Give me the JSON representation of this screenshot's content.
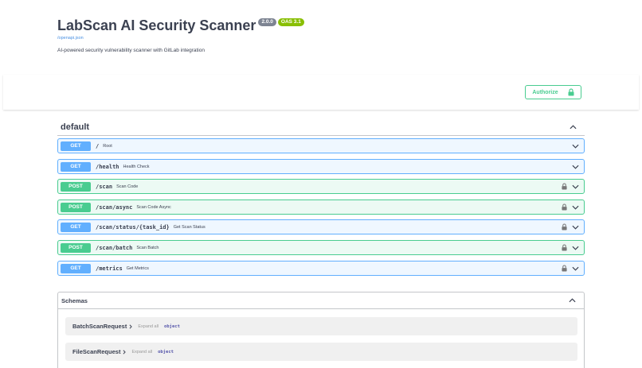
{
  "info": {
    "title": "LabScan AI Security Scanner",
    "version": "2.0.0",
    "oas": "OAS 3.1",
    "spec_link": "/openapi.json",
    "description": "AI-powered security vulnerability scanner with GitLab integration"
  },
  "authorize": {
    "label": "Authorize"
  },
  "tag": {
    "name": "default"
  },
  "operations": [
    {
      "method": "GET",
      "path": "/",
      "summary": "Root",
      "locked": false
    },
    {
      "method": "GET",
      "path": "/health",
      "summary": "Health Check",
      "locked": false
    },
    {
      "method": "POST",
      "path": "/scan",
      "summary": "Scan Code",
      "locked": true
    },
    {
      "method": "POST",
      "path": "/scan/async",
      "summary": "Scan Code Async",
      "locked": true
    },
    {
      "method": "GET",
      "path": "/scan/status/{task_id}",
      "summary": "Get Scan Status",
      "locked": true
    },
    {
      "method": "POST",
      "path": "/scan/batch",
      "summary": "Scan Batch",
      "locked": true
    },
    {
      "method": "GET",
      "path": "/metrics",
      "summary": "Get Metrics",
      "locked": true
    }
  ],
  "schemas": {
    "title": "Schemas",
    "items": [
      {
        "name": "BatchScanRequest",
        "expand_label": "Expand all",
        "type": "object"
      },
      {
        "name": "FileScanRequest",
        "expand_label": "Expand all",
        "type": "object"
      }
    ]
  },
  "icons": {
    "lock": "lock-icon",
    "chevron_down": "chevron-down-icon",
    "chevron_up": "chevron-up-icon",
    "chevron_right": "chevron-right-icon"
  },
  "colors": {
    "get": "#61affe",
    "post": "#49cc90",
    "link": "#4990e2",
    "version_badge": "#7d8492",
    "oas_badge": "#89bf04"
  }
}
